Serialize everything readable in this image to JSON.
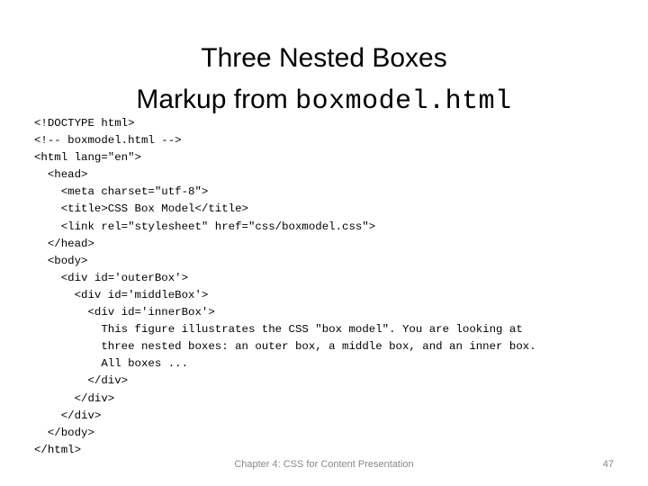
{
  "slide": {
    "title_line1": "Three Nested Boxes",
    "title_line2_prefix": "Markup from ",
    "title_line2_file": "boxmodel.html",
    "footer": "Chapter 4: CSS for Content Presentation",
    "page_number": "47",
    "footer_color": "#898989",
    "text_color": "#000000",
    "background_color": "#ffffff"
  },
  "code": {
    "language": "html",
    "lines": [
      "<!DOCTYPE html>",
      "<!-- boxmodel.html -->",
      "<html lang=\"en\">",
      "  <head>",
      "    <meta charset=\"utf-8\">",
      "    <title>CSS Box Model</title>",
      "    <link rel=\"stylesheet\" href=\"css/boxmodel.css\">",
      "  </head>",
      "  <body>",
      "    <div id='outerBox'>",
      "      <div id='middleBox'>",
      "        <div id='innerBox'>",
      "          This figure illustrates the CSS \"box model\". You are looking at",
      "          three nested boxes: an outer box, a middle box, and an inner box.",
      "          All boxes ...",
      "        </div>",
      "      </div>",
      "    </div>",
      "  </body>",
      "</html>"
    ]
  }
}
